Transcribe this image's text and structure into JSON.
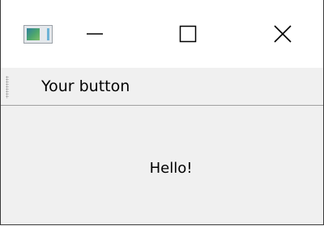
{
  "window": {
    "icon": "app-window-icon",
    "controls": {
      "minimize_icon": "minimize-icon",
      "maximize_icon": "maximize-icon",
      "close_icon": "close-icon"
    }
  },
  "toolbar": {
    "button_label": "Your button"
  },
  "content": {
    "label": "Hello!"
  }
}
